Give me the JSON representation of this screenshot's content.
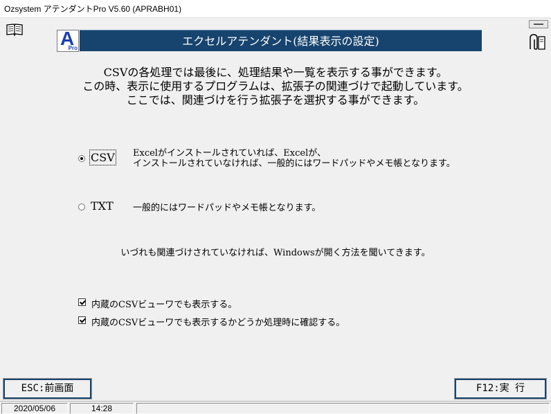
{
  "window": {
    "title": "Ozsystem アテンダントPro V5.60 (APRABH01)"
  },
  "header": {
    "title": "エクセルアテンダント(結果表示の設定)",
    "logo_letter": "A",
    "logo_sub": "Pro"
  },
  "intro": {
    "line1": "CSVの各処理では最後に、処理結果や一覧を表示する事ができます。",
    "line2": "この時、表示に使用するプログラムは、拡張子の関連づけで起動しています。",
    "line3": "ここでは、関連づけを行う拡張子を選択する事ができます。"
  },
  "options": {
    "csv": {
      "label": "CSV",
      "selected": true,
      "desc1": "Excelがインストールされていれば、Excelが、",
      "desc2": "インストールされていなければ、一般的にはワードパッドやメモ帳となります。"
    },
    "txt": {
      "label": "TXT",
      "selected": false,
      "desc": "一般的にはワードパッドやメモ帳となります。"
    }
  },
  "note": "いづれも関連づけされていなければ、Windowsが開く方法を聞いてきます。",
  "checks": {
    "show_viewer": {
      "label": "内蔵のCSVビューワでも表示する。",
      "checked": true
    },
    "confirm_viewer": {
      "label": "内蔵のCSVビューワでも表示するかどうか処理時に確認する。",
      "checked": true
    }
  },
  "buttons": {
    "esc": "ESC:前画面",
    "f12": "F12:実 行"
  },
  "status": {
    "date": "2020/05/06",
    "time": "14:28"
  },
  "colors": {
    "header_bg": "#17446e",
    "logo_blue": "#1a3fb0"
  },
  "icons": {
    "help": "book-icon",
    "attach": "clip-icon"
  }
}
